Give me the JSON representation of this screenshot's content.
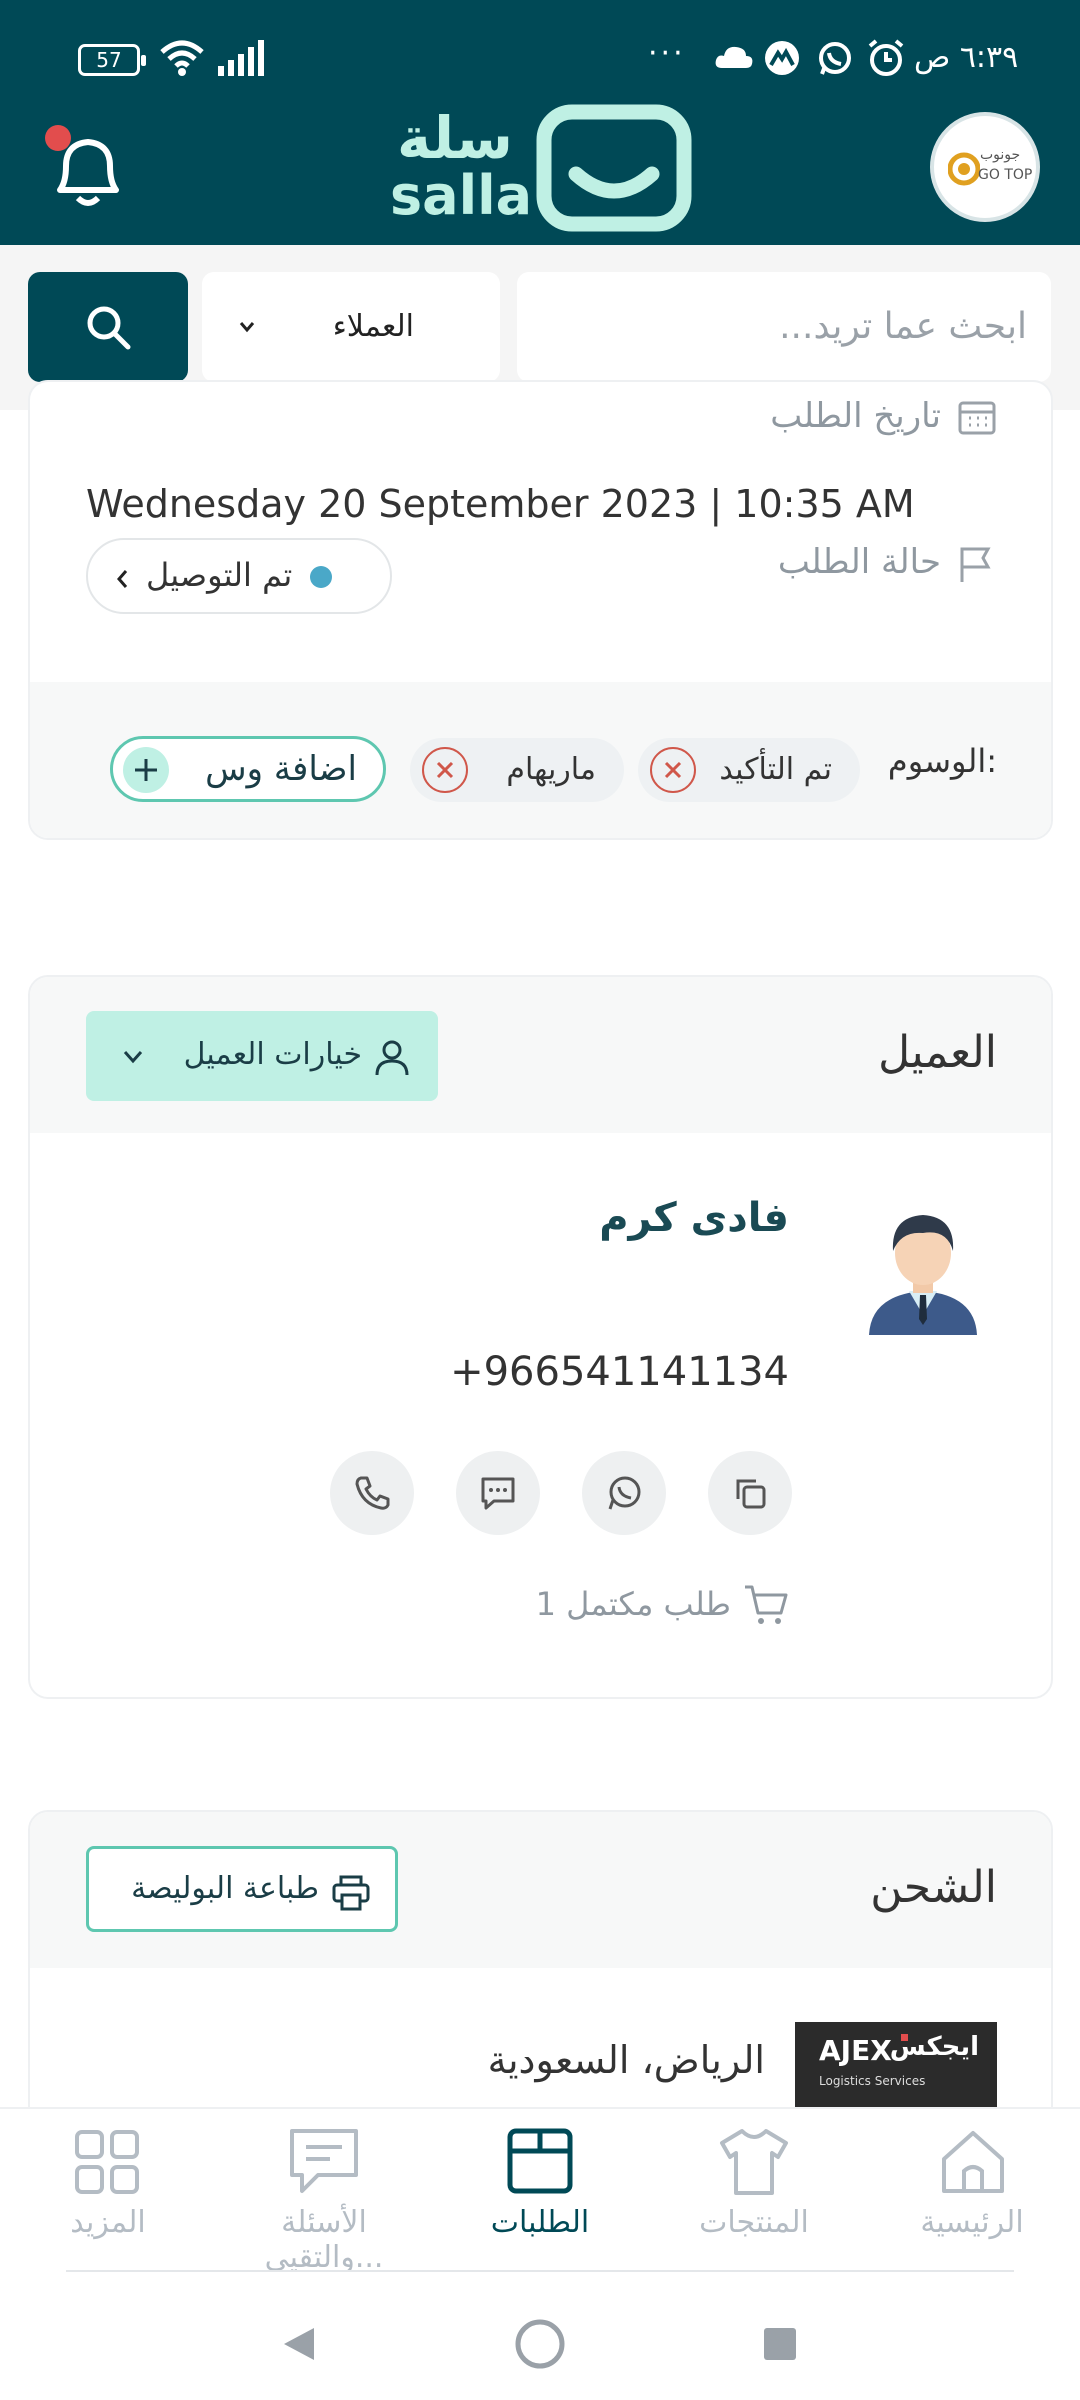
{
  "status_bar": {
    "battery": "57",
    "time": "٦:٣٩ ص",
    "more": "···"
  },
  "header": {
    "brand_ar": "سلة",
    "brand_en": "salla",
    "store_logo_ar": "جونوب",
    "store_logo_en": "GO TOP"
  },
  "search": {
    "placeholder": "ابحث عما تريد...",
    "filter_value": "العملاء"
  },
  "order": {
    "date_label": "تاريخ الطلب",
    "date_value": "Wednesday 20 September 2023 | 10:35 AM",
    "status_label": "حالة الطلب",
    "status_value": "تم التوصيل",
    "status_color": "#4aa8c8",
    "tags_label": "الوسوم:",
    "tags": [
      "تم التأكيد",
      "ماريهام"
    ],
    "add_tag_label": "اضافة وس"
  },
  "customer": {
    "section_title": "العميل",
    "options_label": "خيارات العميل",
    "name": "فادى كرم",
    "phone": "+966541141134",
    "orders_completed": "1 طلب مكتمل"
  },
  "shipping": {
    "section_title": "الشحن",
    "print_label": "طباعة البوليصة",
    "carrier_logo_en": "AJEX",
    "carrier_logo_ar": "ايجكس",
    "carrier_sub": "Logistics Services",
    "location": "الرياض، السعودية"
  },
  "bottom_nav": {
    "items": [
      {
        "label": "الرئيسية",
        "icon": "home-icon"
      },
      {
        "label": "المنتجات",
        "icon": "shirt-icon"
      },
      {
        "label": "الطلبات",
        "icon": "box-icon"
      },
      {
        "label": "الأسئلة والتقيي...",
        "icon": "chat-icon"
      },
      {
        "label": "المزيد",
        "icon": "grid-icon"
      }
    ],
    "active_index": 2
  },
  "colors": {
    "primary": "#004956",
    "accent": "#bff0e4",
    "accent_dark": "#5ec7b0",
    "danger": "#d0574a"
  }
}
